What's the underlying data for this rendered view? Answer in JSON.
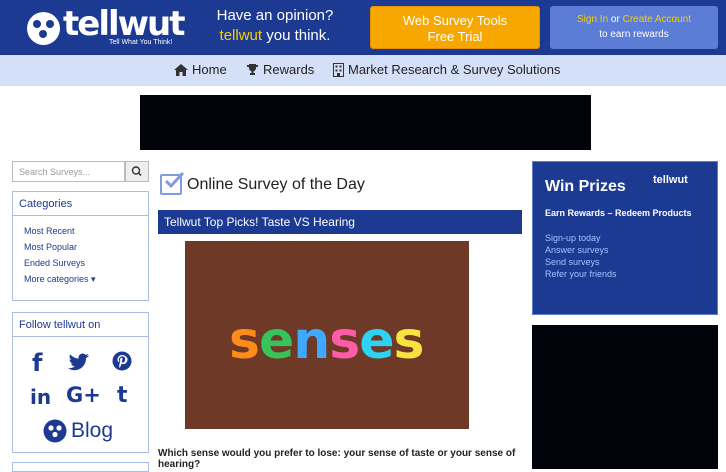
{
  "header": {
    "logo_text": "tellwut",
    "logo_tagline": "Tell What You Think!",
    "opinion_line1": "Have an opinion?",
    "opinion_brand": "tellwut",
    "opinion_suffix": "you think.",
    "trial_line1": "Web Survey Tools",
    "trial_line2": "Free Trial",
    "signin": "Sign In",
    "or": "or",
    "create_account": "Create Account",
    "earn_rewards": "to earn rewards"
  },
  "nav": {
    "home": "Home",
    "rewards": "Rewards",
    "market": "Market Research & Survey Solutions"
  },
  "search": {
    "placeholder": "Search Surveys..."
  },
  "categories": {
    "heading": "Categories",
    "items": [
      "Most Recent",
      "Most Popular",
      "Ended Surveys",
      "More categories ▾"
    ]
  },
  "follow": {
    "heading": "Follow tellwut on",
    "blog": "Blog"
  },
  "main": {
    "section_title": "Online Survey of the Day",
    "survey_title": "Tellwut Top Picks! Taste VS Hearing",
    "image_word": "senses",
    "question": "Which sense would you prefer to lose: your sense of taste or your sense of hearing?"
  },
  "side_ad": {
    "title": "Win Prizes",
    "brand": "tellwut",
    "subtitle": "Earn Rewards – Redeem Products",
    "steps": [
      "Sign-up today",
      "Answer surveys",
      "Send surveys",
      "Refer your friends"
    ]
  },
  "colors": {
    "header_bg": "#1d3a93",
    "nav_bg": "#d4e0f8",
    "trial_bg": "#f7a800",
    "accent_yellow": "#f7d000"
  }
}
